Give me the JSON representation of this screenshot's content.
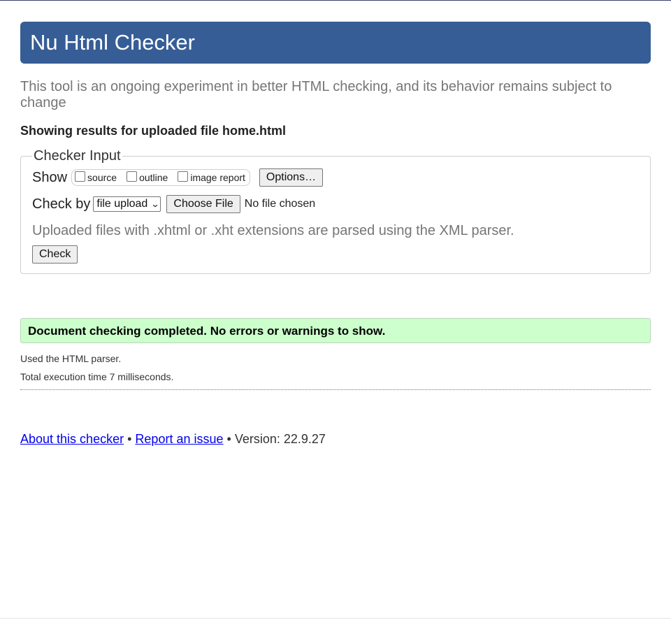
{
  "header": {
    "title": "Nu Html Checker"
  },
  "intro": "This tool is an ongoing experiment in better HTML checking, and its behavior remains subject to change",
  "results_for": "Showing results for uploaded file home.html",
  "checker_input": {
    "legend": "Checker Input",
    "show_label": "Show",
    "show_options": [
      {
        "label": "source",
        "checked": false
      },
      {
        "label": "outline",
        "checked": false
      },
      {
        "label": "image report",
        "checked": false
      }
    ],
    "options_button": "Options…",
    "check_by_label": "Check by",
    "check_by_select": "file upload",
    "choose_file_button": "Choose File",
    "no_file_text": "No file chosen",
    "parser_note": "Uploaded files with .xhtml or .xht extensions are parsed using the XML parser.",
    "check_button": "Check"
  },
  "result": {
    "success_message": "Document checking completed. No errors or warnings to show.",
    "parser_used": "Used the HTML parser.",
    "execution_time": "Total execution time 7 milliseconds."
  },
  "footer": {
    "about_link": "About this checker",
    "separator": "•",
    "report_link": "Report an issue",
    "version": "Version: 22.9.27"
  },
  "colors": {
    "header_bg": "#365d95",
    "success_bg": "#ccffcc",
    "link": "#0000ee"
  }
}
